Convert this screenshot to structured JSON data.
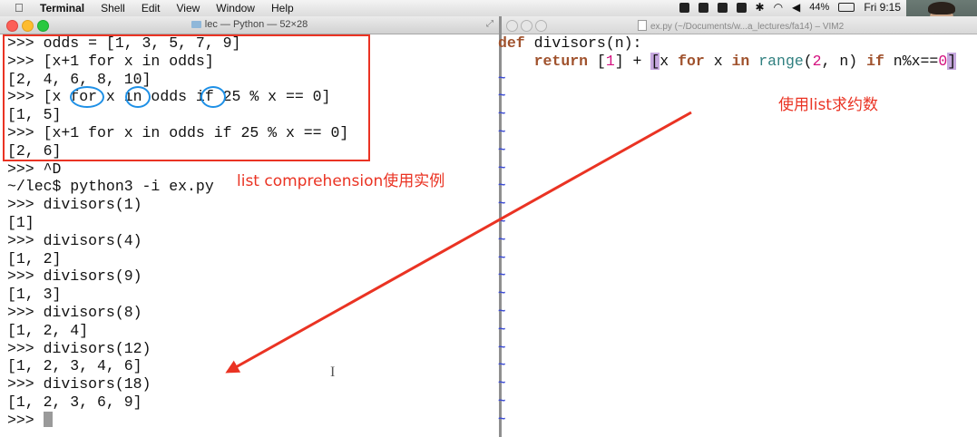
{
  "menubar": {
    "apple": "",
    "items": [
      "Terminal",
      "Shell",
      "Edit",
      "View",
      "Window",
      "Help"
    ],
    "battery": "44%",
    "clock": "Fri 9:15"
  },
  "terminal": {
    "title": "lec — Python — 52×28",
    "lines": [
      ">>> odds = [1, 3, 5, 7, 9]",
      ">>> [x+1 for x in odds]",
      "[2, 4, 6, 8, 10]",
      ">>> [x for x in odds if 25 % x == 0]",
      "[1, 5]",
      ">>> [x+1 for x in odds if 25 % x == 0]",
      "[2, 6]",
      ">>> ^D",
      "~/lec$ python3 -i ex.py",
      ">>> divisors(1)",
      "[1]",
      ">>> divisors(4)",
      "[1, 2]",
      ">>> divisors(9)",
      "[1, 3]",
      ">>> divisors(8)",
      "[1, 2, 4]",
      ">>> divisors(12)",
      "[1, 2, 3, 4, 6]",
      ">>> divisors(18)",
      "[1, 2, 3, 6, 9]",
      ">>> "
    ]
  },
  "vim": {
    "title": "ex.py (~/Documents/w...a_lectures/fa14) – VIM2",
    "line1": {
      "kw": "def",
      "rest": " divisors(n):"
    },
    "line2": {
      "indent": "    ",
      "kw_return": "return",
      "open": " [",
      "one": "1",
      "mid": "] + ",
      "bracket": "[",
      "x": "x ",
      "kw_for": "for",
      "x2": " x ",
      "kw_in": "in",
      "sp": " ",
      "fn": "range",
      "paren": "(",
      "two": "2",
      "tail": ", n) ",
      "kw_if": "if",
      "cond": " n%x==",
      "zero": "0",
      "close": "]"
    },
    "tilde": "~"
  },
  "annotations": {
    "left_note": "list comprehension使用实例",
    "right_note": "使用list求约数"
  },
  "colors": {
    "annotation_red": "#ea3323",
    "circle_blue": "#1e90e6"
  }
}
